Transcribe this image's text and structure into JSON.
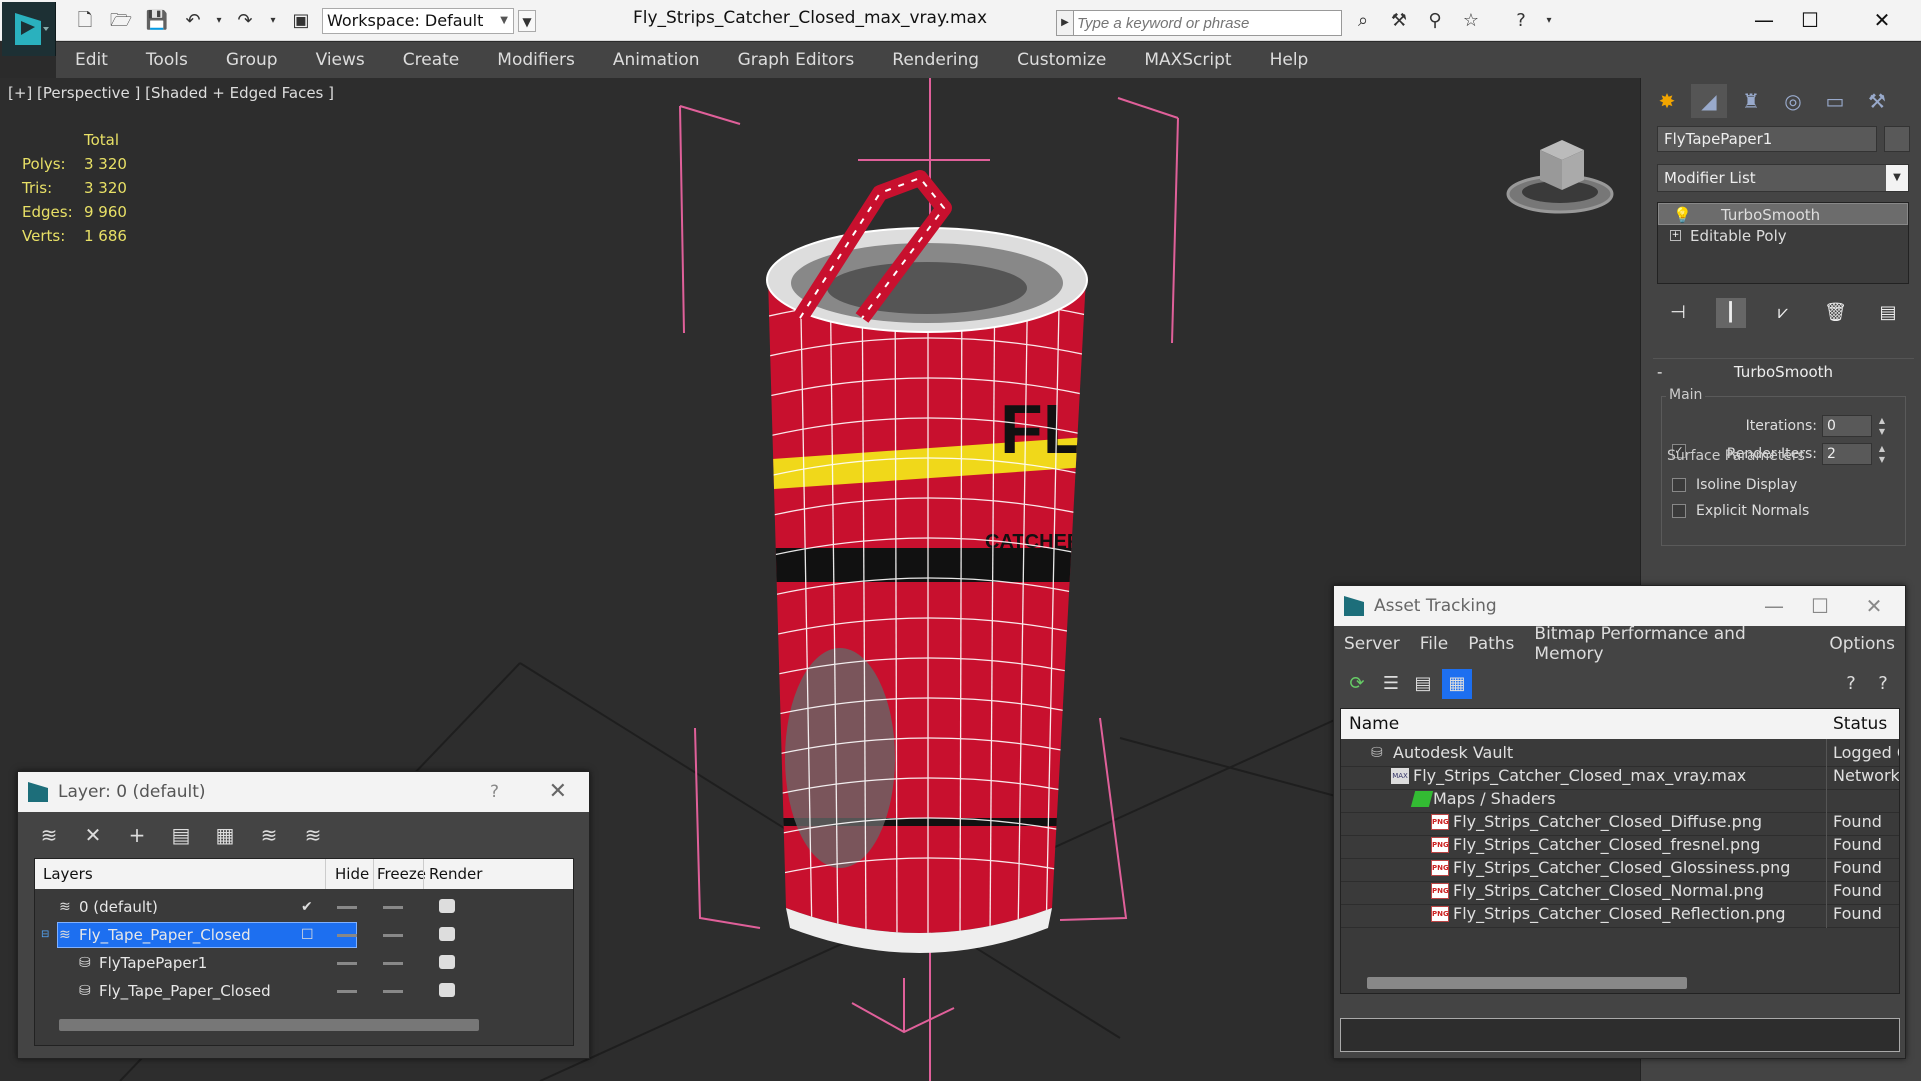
{
  "window": {
    "title": "Fly_Strips_Catcher_Closed_max_vray.max",
    "workspace": "Workspace: Default",
    "search_placeholder": "Type a keyword or phrase"
  },
  "menu": [
    "Edit",
    "Tools",
    "Group",
    "Views",
    "Create",
    "Modifiers",
    "Animation",
    "Graph Editors",
    "Rendering",
    "Customize",
    "MAXScript",
    "Help"
  ],
  "viewport": {
    "label": "[+] [Perspective ] [Shaded + Edged Faces ]",
    "stats": {
      "header": "Total",
      "rows": [
        {
          "key": "Polys:",
          "value": "3 320"
        },
        {
          "key": "Tris:",
          "value": "3 320"
        },
        {
          "key": "Edges:",
          "value": "9 960"
        },
        {
          "key": "Verts:",
          "value": "1 686"
        }
      ]
    },
    "can_text": {
      "brand": "FLY",
      "sub": "CATCHER"
    }
  },
  "command_panel": {
    "object_name": "FlyTapePaper1",
    "modifier_list": "Modifier List",
    "stack": [
      "TurboSmooth",
      "Editable Poly"
    ],
    "rollout_title": "TurboSmooth",
    "main_label": "Main",
    "iterations_label": "Iterations:",
    "iterations_value": "0",
    "render_iters_label": "Render Iters:",
    "render_iters_value": "2",
    "isoline_label": "Isoline Display",
    "explicit_normals_label": "Explicit Normals",
    "surface_params_label": "Surface Parameters"
  },
  "layer_dialog": {
    "title": "Layer: 0 (default)",
    "help": "?",
    "columns": {
      "layers": "Layers",
      "hide": "Hide",
      "freeze": "Freeze",
      "render": "Render"
    },
    "rows": [
      {
        "name": "0 (default)",
        "indent": 0
      },
      {
        "name": "Fly_Tape_Paper_Closed",
        "indent": 0
      },
      {
        "name": "FlyTapePaper1",
        "indent": 1
      },
      {
        "name": "Fly_Tape_Paper_Closed",
        "indent": 1
      }
    ]
  },
  "asset_dialog": {
    "title": "Asset Tracking",
    "menu": [
      "Server",
      "File",
      "Paths",
      "Bitmap Performance and Memory",
      "Options"
    ],
    "columns": {
      "name": "Name",
      "status": "Status"
    },
    "rows": [
      {
        "name": "Autodesk Vault",
        "status": "Logged C",
        "level": 0,
        "icon": "vault"
      },
      {
        "name": "Fly_Strips_Catcher_Closed_max_vray.max",
        "status": "Network",
        "level": 1,
        "icon": "max"
      },
      {
        "name": "Maps / Shaders",
        "status": "",
        "level": 2,
        "icon": "maps"
      },
      {
        "name": "Fly_Strips_Catcher_Closed_Diffuse.png",
        "status": "Found",
        "level": 3,
        "icon": "png"
      },
      {
        "name": "Fly_Strips_Catcher_Closed_fresnel.png",
        "status": "Found",
        "level": 3,
        "icon": "png"
      },
      {
        "name": "Fly_Strips_Catcher_Closed_Glossiness.png",
        "status": "Found",
        "level": 3,
        "icon": "png"
      },
      {
        "name": "Fly_Strips_Catcher_Closed_Normal.png",
        "status": "Found",
        "level": 3,
        "icon": "png"
      },
      {
        "name": "Fly_Strips_Catcher_Closed_Reflection.png",
        "status": "Found",
        "level": 3,
        "icon": "png"
      }
    ],
    "png_label": "PNG"
  }
}
